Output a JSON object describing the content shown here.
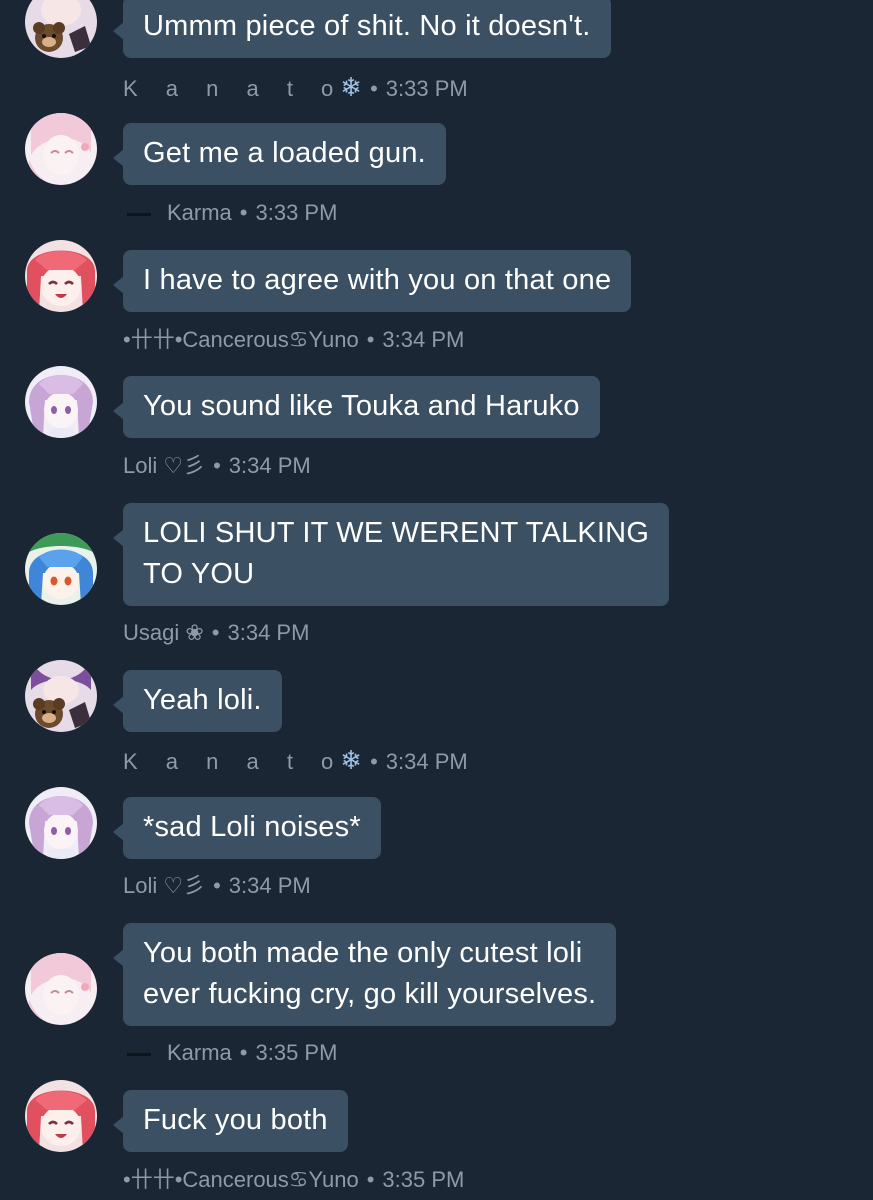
{
  "messages": [
    {
      "avatar": "kanato-teddy-avatar",
      "text": "Ummm piece of shit. No it doesn't.",
      "author": "K a n a t o",
      "author_icon": "❄",
      "time": "3:33 PM"
    },
    {
      "avatar": "karma-pink-avatar",
      "text": "Get me a loaded gun.",
      "author": "Karma",
      "author_prefix": "dash",
      "time": "3:33 PM"
    },
    {
      "avatar": "yuno-red-hair-avatar",
      "text": "I have to agree with you on that one",
      "author": "•卄卄•Cancerous♋Yuno",
      "time": "3:34 PM"
    },
    {
      "avatar": "loli-lavender-avatar",
      "text": "You sound like Touka and Haruko",
      "author": "Loli ♡彡",
      "time": "3:34 PM"
    },
    {
      "avatar": "usagi-blue-hair-avatar",
      "text": "LOLI SHUT IT WE WERENT TALKING TO YOU",
      "text_line1": "LOLI SHUT IT WE WERENT TALKING",
      "text_line2": "TO YOU",
      "author": "Usagi ❀",
      "time": "3:34 PM"
    },
    {
      "avatar": "kanato-teddy-avatar",
      "text": "Yeah loli.",
      "author": "K a n a t o",
      "author_icon": "❄",
      "time": "3:34 PM"
    },
    {
      "avatar": "loli-lavender-avatar",
      "text": "*sad Loli noises*",
      "author": "Loli ♡彡",
      "time": "3:34 PM"
    },
    {
      "avatar": "karma-pink-avatar",
      "text": "You both made the only cutest loli ever fucking cry, go kill yourselves.",
      "text_line1": "You both made the only cutest loli",
      "text_line2": "ever fucking cry, go kill yourselves.",
      "author": "Karma",
      "author_prefix": "dash",
      "time": "3:35 PM"
    },
    {
      "avatar": "yuno-red-hair-avatar",
      "text": "Fuck you both",
      "author": "•卄卄•Cancerous♋Yuno",
      "time": "3:35 PM"
    }
  ],
  "separator": "•",
  "colors": {
    "background": "#1b2634",
    "bubble": "#3c5064",
    "meta_text": "#8d9aa8",
    "snowflake": "#9ec3e6"
  }
}
